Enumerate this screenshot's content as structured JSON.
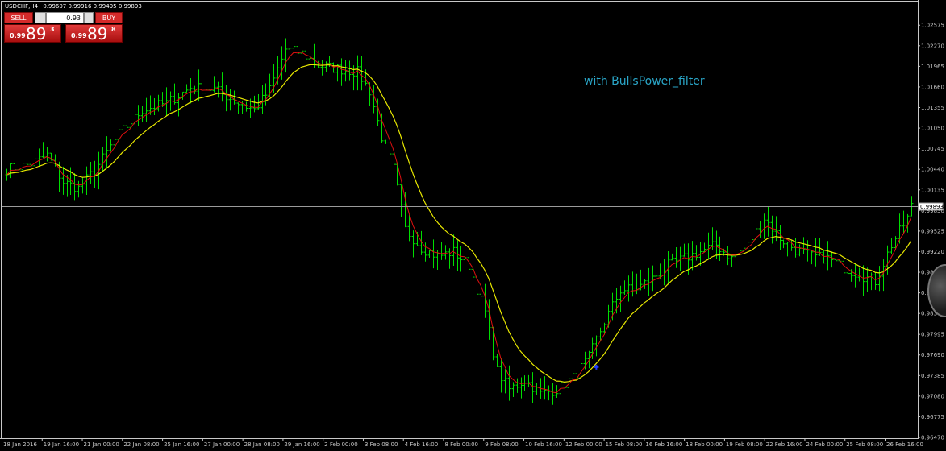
{
  "window": {
    "symbol_label": "USDCHF,H4",
    "ohlc_label": "0.99607 0.99916 0.99495 0.99893"
  },
  "annotation": "with BullsPower_filter",
  "trade_panel": {
    "sell_label": "SELL",
    "buy_label": "BUY",
    "lot_value": "0.93",
    "sell_price": {
      "prefix": "0.99",
      "big": "89",
      "sup": "3"
    },
    "buy_price": {
      "prefix": "0.99",
      "big": "89",
      "sup": "8"
    }
  },
  "colors": {
    "background": "#000000",
    "candles": "#00dd00",
    "fast_ma": "#e01010",
    "slow_ma": "#e8e800",
    "price_line": "#9a9a9a",
    "signal": "#1e3cff",
    "accent": "#d42a2a"
  },
  "chart_data": {
    "type": "ohlc",
    "grid": false,
    "y_range": [
      0.9647,
      1.029
    ],
    "y_ticks": [
      {
        "value": 1.02575,
        "label": "1.02575"
      },
      {
        "value": 1.0227,
        "label": "1.02270"
      },
      {
        "value": 1.01965,
        "label": "1.01965"
      },
      {
        "value": 1.0166,
        "label": "1.01660"
      },
      {
        "value": 1.01355,
        "label": "1.01355"
      },
      {
        "value": 1.0105,
        "label": "1.01050"
      },
      {
        "value": 1.00745,
        "label": "1.00745"
      },
      {
        "value": 1.0044,
        "label": "1.00440"
      },
      {
        "value": 1.00135,
        "label": "1.00135"
      },
      {
        "value": 0.9983,
        "label": "0.99830"
      },
      {
        "value": 0.99525,
        "label": "0.99525"
      },
      {
        "value": 0.9922,
        "label": "0.99220"
      },
      {
        "value": 0.98915,
        "label": "0.98915"
      },
      {
        "value": 0.9861,
        "label": "0.98610"
      },
      {
        "value": 0.98305,
        "label": "0.98305"
      },
      {
        "value": 0.97995,
        "label": "0.97995"
      },
      {
        "value": 0.9769,
        "label": "0.97690"
      },
      {
        "value": 0.97385,
        "label": "0.97385"
      },
      {
        "value": 0.9708,
        "label": "0.97080"
      },
      {
        "value": 0.96775,
        "label": "0.96775"
      },
      {
        "value": 0.9647,
        "label": "0.96470"
      }
    ],
    "x_ticks": [
      "18 Jan 2016",
      "19 Jan 16:00",
      "21 Jan 00:00",
      "22 Jan 08:00",
      "25 Jan 16:00",
      "27 Jan 00:00",
      "28 Jan 08:00",
      "29 Jan 16:00",
      "2 Feb 00:00",
      "3 Feb 08:00",
      "4 Feb 16:00",
      "8 Feb 00:00",
      "9 Feb 08:00",
      "10 Feb 16:00",
      "12 Feb 00:00",
      "15 Feb 08:00",
      "16 Feb 16:00",
      "18 Feb 00:00",
      "19 Feb 08:00",
      "22 Feb 16:00",
      "24 Feb 00:00",
      "25 Feb 08:00",
      "26 Feb 16:00"
    ],
    "current_price": 0.99893,
    "current_price_label": "0.99893",
    "signals": [
      {
        "bar": 148,
        "price": 0.9751,
        "color": "#1e3cff"
      }
    ],
    "anchors": [
      [
        0,
        1.0044
      ],
      [
        6,
        1.0052
      ],
      [
        10,
        1.0065
      ],
      [
        14,
        1.0025
      ],
      [
        18,
        1.0016
      ],
      [
        22,
        1.0042
      ],
      [
        28,
        1.0096
      ],
      [
        34,
        1.0132
      ],
      [
        40,
        1.0142
      ],
      [
        46,
        1.0165
      ],
      [
        52,
        1.0163
      ],
      [
        58,
        1.0142
      ],
      [
        62,
        1.0132
      ],
      [
        66,
        1.0162
      ],
      [
        70,
        1.0222
      ],
      [
        74,
        1.0216
      ],
      [
        78,
        1.0198
      ],
      [
        84,
        1.0192
      ],
      [
        88,
        1.0188
      ],
      [
        91,
        1.016
      ],
      [
        94,
        1.0092
      ],
      [
        97,
        1.0045
      ],
      [
        100,
        0.9955
      ],
      [
        104,
        0.9928
      ],
      [
        108,
        0.9915
      ],
      [
        112,
        0.9922
      ],
      [
        116,
        0.9902
      ],
      [
        120,
        0.9832
      ],
      [
        123,
        0.9745
      ],
      [
        126,
        0.9718
      ],
      [
        130,
        0.9732
      ],
      [
        134,
        0.9712
      ],
      [
        138,
        0.9718
      ],
      [
        142,
        0.9735
      ],
      [
        146,
        0.9765
      ],
      [
        150,
        0.9818
      ],
      [
        154,
        0.9865
      ],
      [
        158,
        0.9868
      ],
      [
        162,
        0.9882
      ],
      [
        166,
        0.9902
      ],
      [
        170,
        0.9912
      ],
      [
        174,
        0.9922
      ],
      [
        178,
        0.9932
      ],
      [
        182,
        0.9912
      ],
      [
        186,
        0.9932
      ],
      [
        190,
        0.9972
      ],
      [
        194,
        0.9942
      ],
      [
        198,
        0.9925
      ],
      [
        202,
        0.9915
      ],
      [
        206,
        0.9912
      ],
      [
        210,
        0.9898
      ],
      [
        214,
        0.9888
      ],
      [
        218,
        0.9878
      ],
      [
        222,
        0.9932
      ],
      [
        226,
        0.9972
      ],
      [
        227,
        0.9989
      ]
    ]
  }
}
